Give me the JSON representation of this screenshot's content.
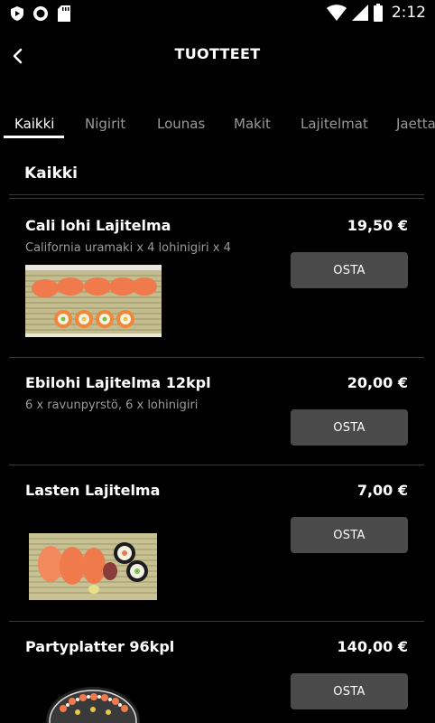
{
  "status_bar": {
    "time": "2:12",
    "icons": [
      "shield-icon",
      "record-icon",
      "sd-card-icon",
      "wifi-icon",
      "signal-icon",
      "battery-icon"
    ]
  },
  "header": {
    "title": "TUOTTEET",
    "back_icon": "chevron-left-icon"
  },
  "tabs": [
    {
      "label": "Kaikki",
      "active": true
    },
    {
      "label": "Nigirit",
      "active": false
    },
    {
      "label": "Lounas",
      "active": false
    },
    {
      "label": "Makit",
      "active": false
    },
    {
      "label": "Lajitelmat",
      "active": false
    },
    {
      "label": "Jaettavat",
      "active": false
    }
  ],
  "section": {
    "title": "Kaikki"
  },
  "products": [
    {
      "name": "Cali lohi Lajitelma",
      "price": "19,50 €",
      "description": "California uramaki x 4 lohinigiri x 4",
      "buy_label": "OSTA",
      "image": "sushi-platter-image"
    },
    {
      "name": "Ebilohi Lajitelma 12kpl",
      "price": "20,00 €",
      "description": "6 x ravunpyrstö, 6 x lohinigiri",
      "buy_label": "OSTA"
    },
    {
      "name": "Lasten Lajitelma",
      "price": "7,00 €",
      "description": "",
      "buy_label": "OSTA",
      "image": "sushi-platter-image"
    },
    {
      "name": "Partyplatter 96kpl",
      "price": "140,00 €",
      "description": "",
      "buy_label": "OSTA",
      "image": "party-platter-image"
    }
  ],
  "colors": {
    "background": "#000000",
    "button": "#4a4a4a",
    "muted_text": "#9c9c9c",
    "divider": "#3a3a3a"
  }
}
